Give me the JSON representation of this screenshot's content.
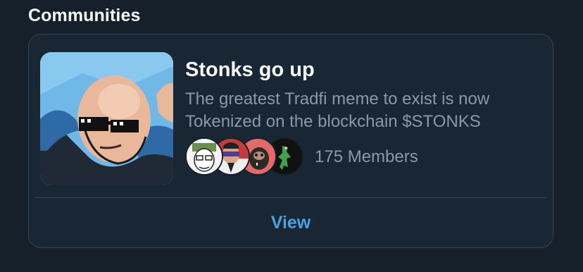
{
  "section": {
    "title": "Communities"
  },
  "community": {
    "name": "Stonks go up",
    "description": "The greatest Tradfi meme to exist is now Tokenized on the blockchain $STONKS",
    "member_count": "175 Members",
    "view_label": "View",
    "image_icon": "stonks-meme-man-image",
    "member_avatars": [
      {
        "icon": "wojak-avatar"
      },
      {
        "icon": "sunglasses-man-avatar"
      },
      {
        "icon": "red-pepe-avatar"
      },
      {
        "icon": "green-lizard-avatar"
      }
    ]
  },
  "colors": {
    "background": "#15202b",
    "card": "#192734",
    "border": "#38444d",
    "primary_text": "#f7f9f9",
    "secondary_text": "#8b98a5",
    "accent": "#4aa2e4"
  }
}
